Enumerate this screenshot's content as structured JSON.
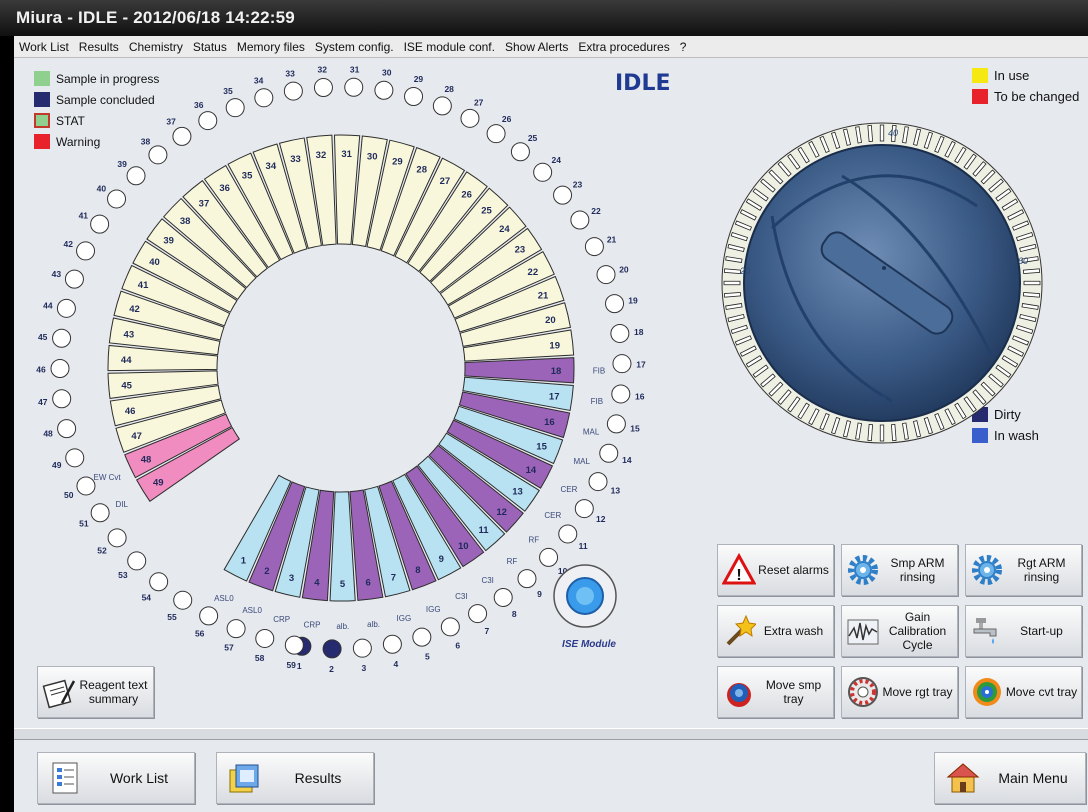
{
  "window": {
    "title": "Miura - IDLE - 2012/06/18 14:22:59"
  },
  "menu": [
    "Work List",
    "Results",
    "Chemistry",
    "Status",
    "Memory files",
    "System config.",
    "ISE module conf.",
    "Show Alerts",
    "Extra procedures",
    "?"
  ],
  "status": "IDLE",
  "legend_left": [
    {
      "label": "Sample in progress",
      "color": "#8fd08f"
    },
    {
      "label": "Sample concluded",
      "color": "#262a6e"
    },
    {
      "label": "STAT",
      "color": "#8fd08f",
      "border": "#c0392b"
    },
    {
      "label": "Warning",
      "color": "#e8222a"
    }
  ],
  "legend_right_top": [
    {
      "label": "In use",
      "color": "#f5e813"
    },
    {
      "label": "To be changed",
      "color": "#e8222a"
    }
  ],
  "legend_right_bottom": [
    {
      "label": "Dirty",
      "color": "#262a6e"
    },
    {
      "label": "In wash",
      "color": "#3a5fcd"
    }
  ],
  "tray": {
    "positions": 49,
    "outer_positions": 59,
    "colors": {
      "cream": "#f8f7dc",
      "purple": "#9b64b8",
      "lightblue": "#b8e2f2",
      "pink": "#f08cc0"
    },
    "slot_labels": {
      "1": "ASL0",
      "2": "ASL0",
      "3": "CRP",
      "4": "CRP",
      "5": "alb.",
      "6": "alb.",
      "7": "IGG",
      "8": "IGG",
      "9": "C3I",
      "10": "C3I",
      "11": "RF",
      "12": "RF",
      "13": "CER",
      "14": "CER",
      "15": "MAL",
      "16": "MAL",
      "17": "FIB",
      "18": "FIB",
      "48": "EW Cvt",
      "49": "DIL"
    },
    "dark_positions": [
      "1",
      "2"
    ],
    "rotor_marks": [
      "40",
      "60",
      "20",
      "1 80"
    ],
    "ise_label": "ISE Module"
  },
  "buttons": [
    {
      "label": "Reset alarms",
      "icon": "warning-icon"
    },
    {
      "label": "Smp ARM rinsing",
      "icon": "gear-icon"
    },
    {
      "label": "Rgt ARM rinsing",
      "icon": "gear-icon"
    },
    {
      "label": "Extra wash",
      "icon": "magic-wand-icon"
    },
    {
      "label": "Gain Calibration Cycle",
      "icon": "waveform-icon"
    },
    {
      "label": "Start-up",
      "icon": "faucet-icon"
    },
    {
      "label": "Move smp tray",
      "icon": "sample-tray-icon"
    },
    {
      "label": "Move rgt tray",
      "icon": "reagent-tray-icon"
    },
    {
      "label": "Move cvt tray",
      "icon": "cuvette-tray-icon"
    }
  ],
  "reagent_button": {
    "label": "Reagent text summary",
    "icon": "document-pen-icon"
  },
  "bottom_buttons": [
    {
      "label": "Work List",
      "icon": "worklist-icon"
    },
    {
      "label": "Results",
      "icon": "results-icon"
    },
    {
      "label": "Main Menu",
      "icon": "home-icon"
    }
  ]
}
